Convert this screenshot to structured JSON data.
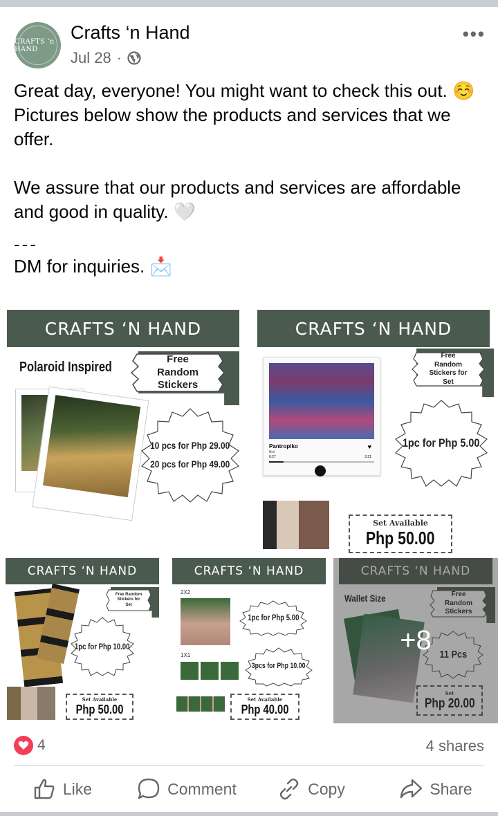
{
  "post": {
    "page_name": "Crafts ‘n Hand",
    "avatar_text": "CRAFTS ‘n HAND",
    "date": "Jul 28",
    "separator": "·",
    "more_label": "•••",
    "text_line1": "Great day, everyone! You might want to check this out. ☺️ Pictures below show the products and services that we offer.",
    "text_line2": "We assure that our products and services are affordable and good in quality. 🤍",
    "text_dashes": "---",
    "text_line3": "DM for inquiries. 📩"
  },
  "grid": {
    "banner": "CRAFTS ‘N HAND",
    "tile1": {
      "title": "Polaroid Inspired",
      "ribbon": "Free Random Stickers",
      "price1": "10 pcs for Php 29.00",
      "price2": "20 pcs for Php 49.00"
    },
    "tile2": {
      "ribbon": "Free Random Stickers for Set",
      "song": "Pantropiko",
      "artist": "Bini",
      "time_start": "0:27",
      "time_end": "3:21",
      "price": "1pc for Php 5.00",
      "set_label": "Set Available",
      "set_price": "Php 50.00"
    },
    "tile3": {
      "ribbon": "Free Random Stickers for Set",
      "price": "1pc for Php 10.00",
      "set_label": "Set Available",
      "set_price": "Php 50.00"
    },
    "tile4": {
      "size1": "2X2",
      "size2": "1X1",
      "price1": "1pc for Php 5.00",
      "price2": "3pcs for Php 10.00",
      "set_label": "Set Available",
      "set_price": "Php 40.00"
    },
    "tile5": {
      "title": "Wallet Size",
      "ribbon": "Free Random Stickers",
      "count": "11 Pcs",
      "set_label": "Set",
      "set_price": "Php 20.00",
      "more_overlay": "+8"
    }
  },
  "reactions": {
    "count": "4",
    "shares": "4 shares"
  },
  "actions": {
    "like": "Like",
    "comment": "Comment",
    "copy": "Copy",
    "share": "Share"
  },
  "colors": {
    "banner_green": "#4b5a4e",
    "avatar_green": "#7d9b86",
    "heart_red": "#f33e58",
    "meta_gray": "#65676b"
  }
}
